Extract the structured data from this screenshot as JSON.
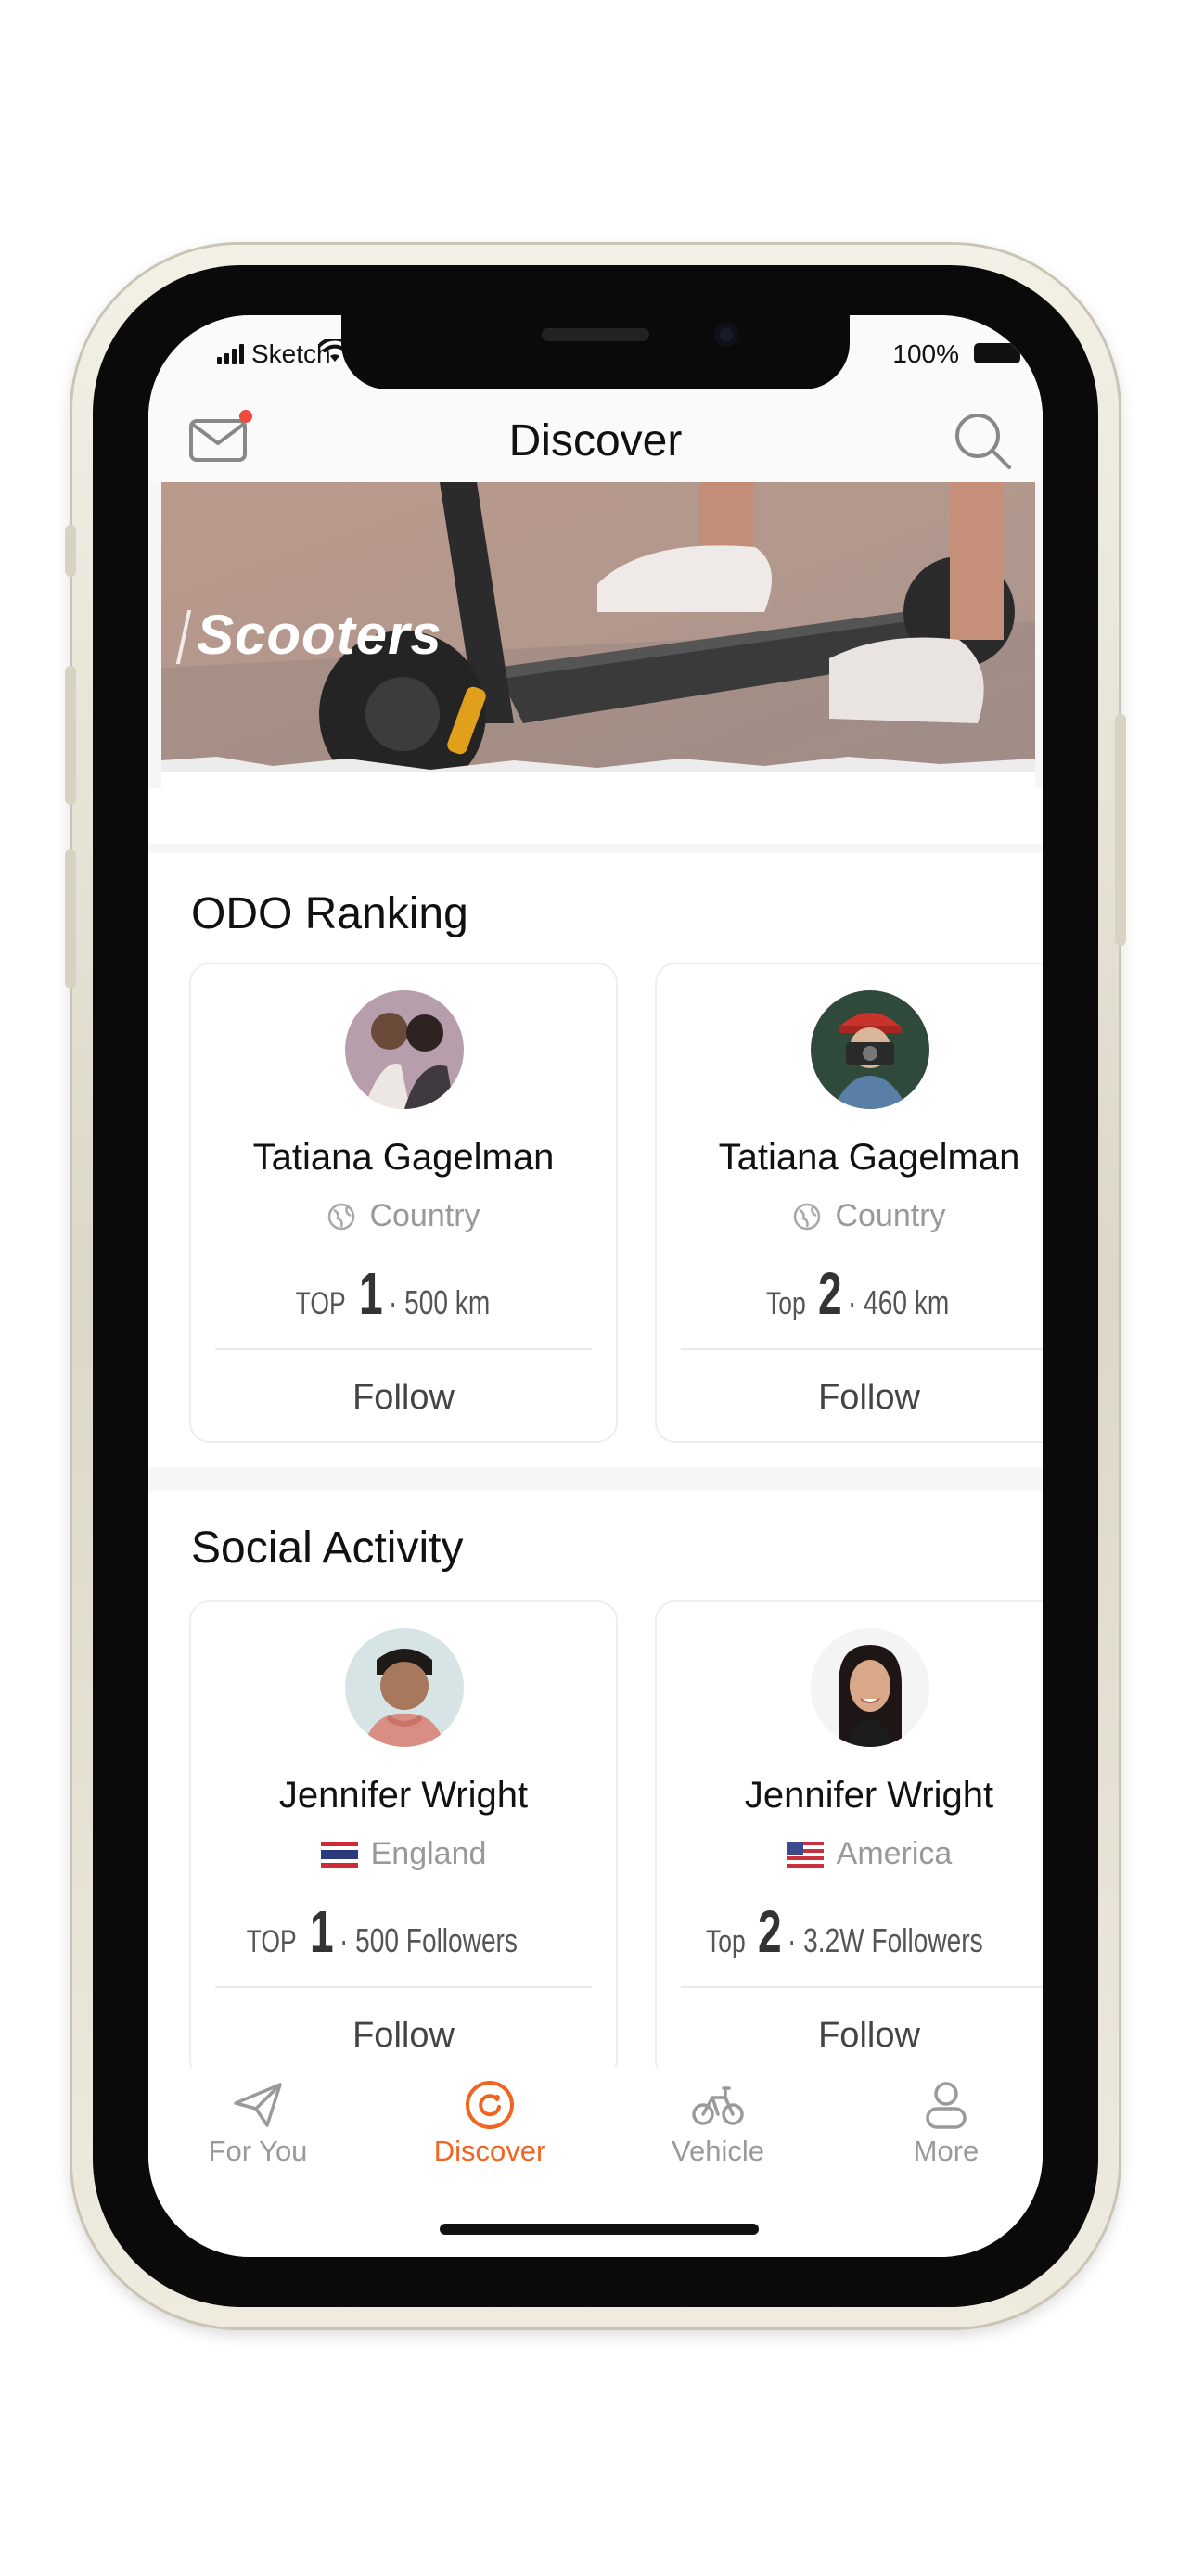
{
  "status_bar": {
    "carrier": "Sketch",
    "battery": "100%"
  },
  "navbar": {
    "title": "Discover",
    "mail_icon": "mail-icon",
    "search_icon": "search-icon"
  },
  "banner": {
    "title": "Scooters"
  },
  "odo_ranking": {
    "title": "ODO Ranking",
    "cards": [
      {
        "name": "Tatiana Gagelman",
        "location": "Country",
        "rank_prefix": "TOP",
        "rank": "1",
        "rank_detail": "· 500 km",
        "follow": "Follow"
      },
      {
        "name": "Tatiana Gagelman",
        "location": "Country",
        "rank_prefix": "Top",
        "rank": "2",
        "rank_detail": "· 460 km",
        "follow": "Follow"
      }
    ]
  },
  "social_activity": {
    "title": "Social Activity",
    "cards": [
      {
        "name": "Jennifer Wright",
        "location": "England",
        "rank_prefix": "TOP",
        "rank": "1",
        "rank_detail": "· 500 Followers",
        "follow": "Follow"
      },
      {
        "name": "Jennifer Wright",
        "location": "America",
        "rank_prefix": "Top",
        "rank": "2",
        "rank_detail": "· 3.2W Followers",
        "follow": "Follow"
      }
    ]
  },
  "tabbar": {
    "items": [
      {
        "label": "For You",
        "icon": "paper-plane-icon"
      },
      {
        "label": "Discover",
        "icon": "compass-refresh-icon",
        "active": true
      },
      {
        "label": "Vehicle",
        "icon": "bicycle-icon"
      },
      {
        "label": "More",
        "icon": "person-icon"
      }
    ]
  },
  "colors": {
    "accent": "#f2641f",
    "text": "#111111",
    "muted": "#999999",
    "notification_dot": "#f04a3c"
  }
}
